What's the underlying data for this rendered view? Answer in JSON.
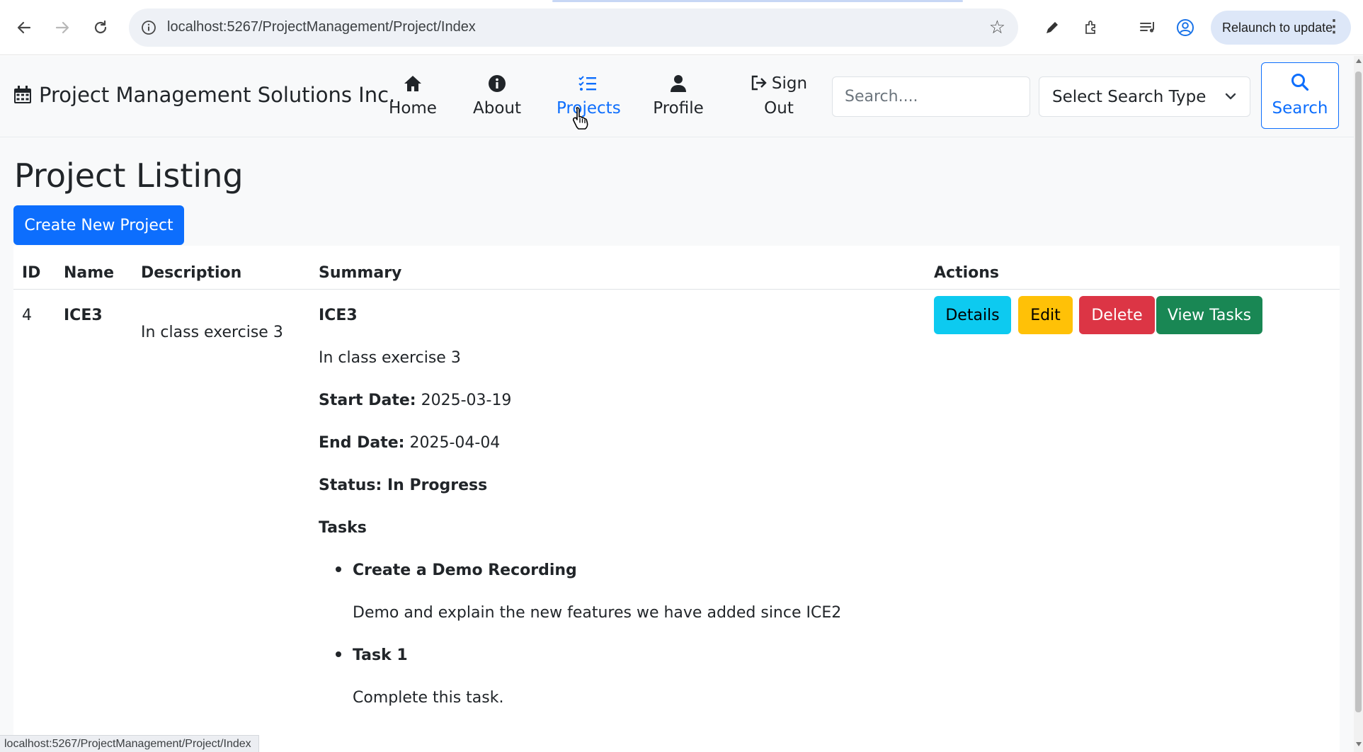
{
  "browser": {
    "url": "localhost:5267/ProjectManagement/Project/Index",
    "relaunch_label": "Relaunch to update",
    "status_url": "localhost:5267/ProjectManagement/Project/Index"
  },
  "navbar": {
    "brand": "Project Management Solutions Inc.",
    "items": [
      {
        "label": "Home",
        "icon": "house-icon"
      },
      {
        "label": "About",
        "icon": "info-circle-icon"
      },
      {
        "label": "Projects",
        "icon": "tasks-list-icon",
        "active": true
      },
      {
        "label": "Profile",
        "icon": "user-icon"
      }
    ],
    "sign_out_line1": "Sign",
    "sign_out_line2": "Out",
    "search_placeholder": "Search....",
    "search_type": "Select Search Type",
    "search_button": "Search"
  },
  "page": {
    "title": "Project Listing",
    "create_button": "Create New Project"
  },
  "table": {
    "headers": [
      "ID",
      "Name",
      "Description",
      "Summary",
      "Actions"
    ],
    "rows": [
      {
        "id": "4",
        "name": "ICE3",
        "description": "In class exercise 3",
        "summary": {
          "name": "ICE3",
          "description": "In class exercise 3",
          "start_label": "Start Date:",
          "start_value": "2025-03-19",
          "end_label": "End Date:",
          "end_value": "2025-04-04",
          "status": "Status: In Progress",
          "tasks_heading": "Tasks",
          "tasks": [
            {
              "title": "Create a Demo Recording",
              "description": "Demo and explain the new features we have added since ICE2"
            },
            {
              "title": "Task 1",
              "description": "Complete this task."
            }
          ]
        },
        "actions": [
          "Details",
          "Edit",
          "Delete",
          "View Tasks"
        ]
      }
    ]
  },
  "colors": {
    "primary": "#0d6efd",
    "info": "#0dcaf0",
    "warning": "#ffc107",
    "danger": "#dc3545",
    "success": "#198754"
  }
}
